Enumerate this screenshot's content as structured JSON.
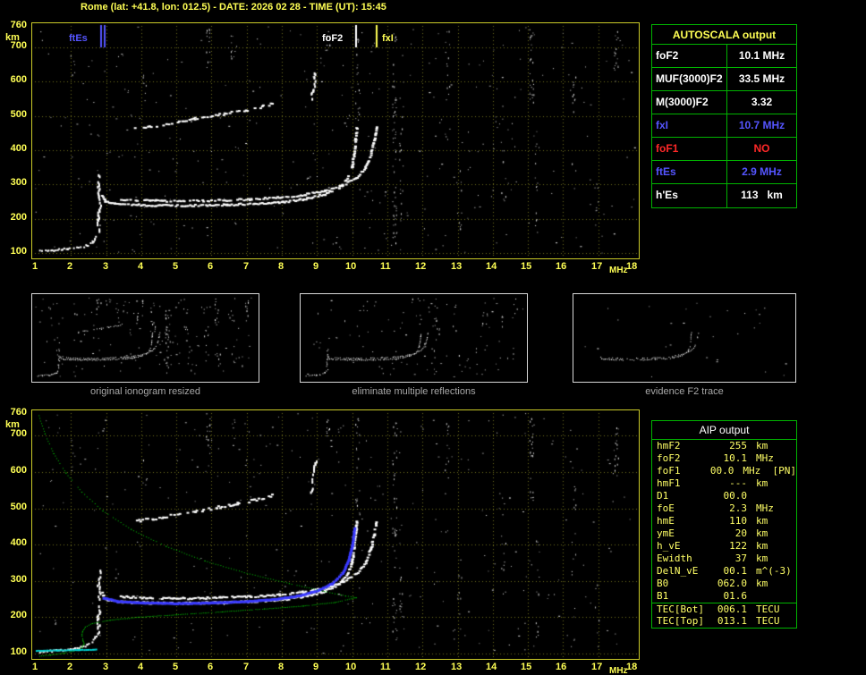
{
  "header": {
    "title": "Rome (lat: +41.8, lon: 012.5) - DATE: 2026 02 28 - TIME (UT): 15:45"
  },
  "colors": {
    "background": "#000000",
    "axis": "#ffff55",
    "grid": "#70701c",
    "plot_border": "#caca28",
    "table_border": "#00b400",
    "blue": "#5555ff",
    "red": "#ff2828",
    "white": "#ffffff",
    "green_profile": "#00c800",
    "cyan": "#00d8d8",
    "caption_gray": "#a8a8a8"
  },
  "autoscala_table": {
    "title": "AUTOSCALA output",
    "rows": [
      {
        "label": "foF2",
        "value": "10.1 MHz",
        "color": "white"
      },
      {
        "label": "MUF(3000)F2",
        "value": "33.5 MHz",
        "color": "white"
      },
      {
        "label": "M(3000)F2",
        "value": "3.32",
        "color": "white"
      },
      {
        "label": "fxI",
        "value": "10.7 MHz",
        "color": "blue"
      },
      {
        "label": "foF1",
        "value": "NO",
        "color": "red"
      },
      {
        "label": "ftEs",
        "value": "2.9 MHz",
        "color": "blue"
      },
      {
        "label": "h'Es",
        "value": "113   km",
        "color": "white"
      }
    ]
  },
  "aip_table": {
    "title": "AIP output",
    "rows": [
      {
        "label": "hmF2",
        "value": "255",
        "unit": "km"
      },
      {
        "label": "foF2",
        "value": "10.1",
        "unit": "MHz"
      },
      {
        "label": "foF1",
        "value": "00.0",
        "unit": "MHz  [PN]"
      },
      {
        "label": "hmF1",
        "value": "---",
        "unit": "km"
      },
      {
        "label": "D1",
        "value": "00.0",
        "unit": ""
      },
      {
        "label": "foE",
        "value": "2.3",
        "unit": "MHz"
      },
      {
        "label": "hmE",
        "value": "110",
        "unit": "km"
      },
      {
        "label": "ymE",
        "value": "20",
        "unit": "km"
      },
      {
        "label": "h_vE",
        "value": "122",
        "unit": "km"
      },
      {
        "label": "Ewidth",
        "value": "37",
        "unit": "km"
      },
      {
        "label": "DelN_vE",
        "value": "00.1",
        "unit": "m^(-3)"
      },
      {
        "label": "B0",
        "value": "062.0",
        "unit": "km"
      },
      {
        "label": "B1",
        "value": "01.6",
        "unit": ""
      },
      {
        "label": "TEC[Bot]",
        "value": "006.1",
        "unit": "TECU",
        "sep": true
      },
      {
        "label": "TEC[Top]",
        "value": "013.1",
        "unit": "TECU"
      }
    ]
  },
  "thumbnails": [
    {
      "caption": "original ionogram resized"
    },
    {
      "caption": "eliminate multiple reflections"
    },
    {
      "caption": "evidence F2 trace"
    }
  ],
  "chart_data": {
    "type": "scatter",
    "title": "Vertical incidence ionogram: virtual height (km) vs sounding frequency (MHz)",
    "x_axis": {
      "label": "MHz",
      "min": 1,
      "max": 18,
      "ticks": [
        1,
        2,
        3,
        4,
        5,
        6,
        7,
        8,
        9,
        10,
        11,
        12,
        13,
        14,
        15,
        16,
        17,
        18
      ]
    },
    "y_axis": {
      "label": "km",
      "min": 100,
      "max": 760,
      "ticks": [
        760,
        700,
        600,
        500,
        400,
        300,
        200,
        100
      ]
    },
    "markers": [
      {
        "label": "ftEs",
        "freq": 2.9,
        "color": "#5555ff",
        "double": true,
        "side": "left"
      },
      {
        "label": "foF2",
        "freq": 10.1,
        "color": "#ffffff",
        "double": false,
        "side": "left"
      },
      {
        "label": "fxI",
        "freq": 10.7,
        "color": "#ffff55",
        "double": false,
        "side": "right"
      }
    ],
    "traces": [
      {
        "name": "Es-trace",
        "f2": false,
        "hop": false,
        "w": 2,
        "h": 2,
        "skip": 0.2,
        "jy": 1.2,
        "points": [
          [
            1.1,
            107
          ],
          [
            1.5,
            110
          ],
          [
            1.9,
            114
          ],
          [
            2.2,
            118
          ],
          [
            2.45,
            125
          ],
          [
            2.6,
            134
          ],
          [
            2.7,
            150
          ]
        ]
      },
      {
        "name": "cusp-spread",
        "f2": false,
        "hop": false,
        "w": 2,
        "h": 3,
        "skip": 0.3,
        "jx": 1.5,
        "points": [
          [
            2.78,
            158
          ],
          [
            2.76,
            200
          ],
          [
            2.8,
            245
          ],
          [
            2.77,
            290
          ],
          [
            2.8,
            330
          ]
        ]
      },
      {
        "name": "F2-ordinary",
        "f2": true,
        "hop": false,
        "w": 3,
        "h": 2,
        "skip": 0.1,
        "jy": 1,
        "points": [
          [
            2.85,
            268
          ],
          [
            2.95,
            252
          ],
          [
            3.2,
            246
          ],
          [
            3.7,
            243
          ],
          [
            4.5,
            241
          ],
          [
            5.5,
            241
          ],
          [
            6.4,
            243
          ],
          [
            7.2,
            246
          ],
          [
            8.0,
            251
          ],
          [
            8.7,
            261
          ],
          [
            9.2,
            274
          ],
          [
            9.6,
            293
          ],
          [
            9.85,
            320
          ],
          [
            9.97,
            355
          ],
          [
            10.03,
            395
          ],
          [
            10.07,
            435
          ],
          [
            10.1,
            468
          ]
        ]
      },
      {
        "name": "F2-extraordinary",
        "f2": true,
        "hop": false,
        "w": 3,
        "h": 2,
        "skip": 0.22,
        "jy": 1,
        "points": [
          [
            3.4,
            259
          ],
          [
            4.2,
            255
          ],
          [
            5.2,
            254
          ],
          [
            6.2,
            256
          ],
          [
            7.1,
            259
          ],
          [
            7.9,
            264
          ],
          [
            8.6,
            272
          ],
          [
            9.2,
            283
          ],
          [
            9.7,
            299
          ],
          [
            10.1,
            322
          ],
          [
            10.35,
            352
          ],
          [
            10.5,
            390
          ],
          [
            10.6,
            430
          ],
          [
            10.66,
            468
          ]
        ]
      },
      {
        "name": "second-hop",
        "f2": false,
        "hop": true,
        "w": 3,
        "h": 2,
        "skip": 0.45,
        "jy": 1.5,
        "points": [
          [
            3.8,
            466
          ],
          [
            4.3,
            473
          ],
          [
            4.9,
            483
          ],
          [
            5.5,
            494
          ],
          [
            6.1,
            504
          ],
          [
            6.7,
            515
          ],
          [
            7.2,
            525
          ],
          [
            7.7,
            537
          ]
        ]
      },
      {
        "name": "second-hop-cusp",
        "f2": false,
        "hop": true,
        "w": 2,
        "h": 3,
        "skip": 0.35,
        "jx": 1.5,
        "points": [
          [
            8.82,
            548
          ],
          [
            8.87,
            575
          ],
          [
            8.9,
            605
          ],
          [
            8.95,
            632
          ]
        ]
      }
    ],
    "noise_columns": [
      {
        "f": 10.15,
        "hmin": 480,
        "hmax": 755,
        "n": 22
      },
      {
        "f": 11.2,
        "hmin": 130,
        "hmax": 745,
        "n": 55
      },
      {
        "f": 11.4,
        "hmin": 200,
        "hmax": 560,
        "n": 16
      },
      {
        "f": 12.7,
        "hmin": 430,
        "hmax": 750,
        "n": 16
      },
      {
        "f": 13.05,
        "hmin": 150,
        "hmax": 360,
        "n": 9
      },
      {
        "f": 14.3,
        "hmin": 250,
        "hmax": 530,
        "n": 12
      },
      {
        "f": 15.1,
        "hmin": 530,
        "hmax": 755,
        "n": 26
      },
      {
        "f": 15.25,
        "hmin": 140,
        "hmax": 430,
        "n": 14
      },
      {
        "f": 16.3,
        "hmin": 270,
        "hmax": 660,
        "n": 14
      },
      {
        "f": 17.5,
        "hmin": 590,
        "hmax": 755,
        "n": 18
      },
      {
        "f": 16.95,
        "hmin": 120,
        "hmax": 300,
        "n": 7
      },
      {
        "f": 5.9,
        "hmin": 650,
        "hmax": 755,
        "n": 12
      },
      {
        "f": 6.6,
        "hmin": 668,
        "hmax": 750,
        "n": 8
      },
      {
        "f": 9.3,
        "hmin": 690,
        "hmax": 755,
        "n": 10
      },
      {
        "f": 4.1,
        "hmin": 560,
        "hmax": 640,
        "n": 5
      },
      {
        "f": 2.05,
        "hmin": 610,
        "hmax": 690,
        "n": 5
      }
    ],
    "profile": {
      "name": "electron-density-profile",
      "color": "#00c800",
      "topside": [
        [
          1.08,
          756
        ],
        [
          1.25,
          706
        ],
        [
          1.5,
          652
        ],
        [
          1.85,
          598
        ],
        [
          2.3,
          546
        ],
        [
          2.9,
          494
        ],
        [
          3.7,
          443
        ],
        [
          4.7,
          396
        ],
        [
          5.8,
          356
        ],
        [
          7.0,
          322
        ],
        [
          8.2,
          294
        ],
        [
          9.2,
          272
        ],
        [
          9.8,
          260
        ],
        [
          10.1,
          255
        ]
      ],
      "bottomside": [
        [
          10.1,
          255
        ],
        [
          9.5,
          242
        ],
        [
          8.6,
          232
        ],
        [
          7.5,
          224
        ],
        [
          6.3,
          216
        ],
        [
          5.0,
          208
        ],
        [
          3.9,
          201
        ],
        [
          3.1,
          193
        ],
        [
          2.6,
          184
        ],
        [
          2.4,
          174
        ],
        [
          2.32,
          162
        ],
        [
          2.3,
          150
        ],
        [
          2.33,
          138
        ],
        [
          2.36,
          128
        ],
        [
          2.3,
          118
        ],
        [
          2.15,
          110
        ],
        [
          1.8,
          102
        ],
        [
          1.4,
          97
        ],
        [
          1.1,
          94
        ]
      ]
    },
    "autoscaled_trace": {
      "name": "autoscaled-F2-trace",
      "color": "#3a3aff",
      "points": [
        [
          2.9,
          256
        ],
        [
          3.3,
          247
        ],
        [
          4.0,
          243
        ],
        [
          5.0,
          241
        ],
        [
          6.0,
          243
        ],
        [
          7.0,
          247
        ],
        [
          7.8,
          253
        ],
        [
          8.5,
          263
        ],
        [
          9.0,
          277
        ],
        [
          9.4,
          296
        ],
        [
          9.7,
          324
        ],
        [
          9.87,
          360
        ],
        [
          9.97,
          400
        ],
        [
          10.04,
          448
        ]
      ]
    },
    "es_reconstructed": {
      "name": "Es-layer-line",
      "color": "#00d8d8",
      "points": [
        [
          1.0,
          110
        ],
        [
          1.6,
          111
        ],
        [
          2.2,
          112
        ],
        [
          2.7,
          113
        ]
      ]
    },
    "plots": {
      "top": {
        "seed": 7,
        "noise": 320,
        "columns": 1.0,
        "traces": "all",
        "markers": true,
        "grid": true,
        "dot": 1
      },
      "bottom": {
        "seed": 13,
        "noise": 300,
        "columns": 0.9,
        "traces": "all",
        "markers": false,
        "grid": true,
        "dot": 1,
        "profile": true,
        "autotrace": true,
        "es_line": true
      },
      "thumb_original": {
        "seed": 21,
        "noise": 140,
        "columns": 0.45,
        "traces": "all",
        "markers": false,
        "grid": false,
        "dot": 0.5
      },
      "thumb_cleaned": {
        "seed": 33,
        "noise": 90,
        "columns": 0.2,
        "traces": "no-hop",
        "markers": false,
        "grid": false,
        "dot": 0.5
      },
      "thumb_f2": {
        "seed": 44,
        "noise": 28,
        "columns": 0,
        "traces": "f2-only",
        "markers": false,
        "grid": false,
        "dot": 0.5
      }
    }
  }
}
